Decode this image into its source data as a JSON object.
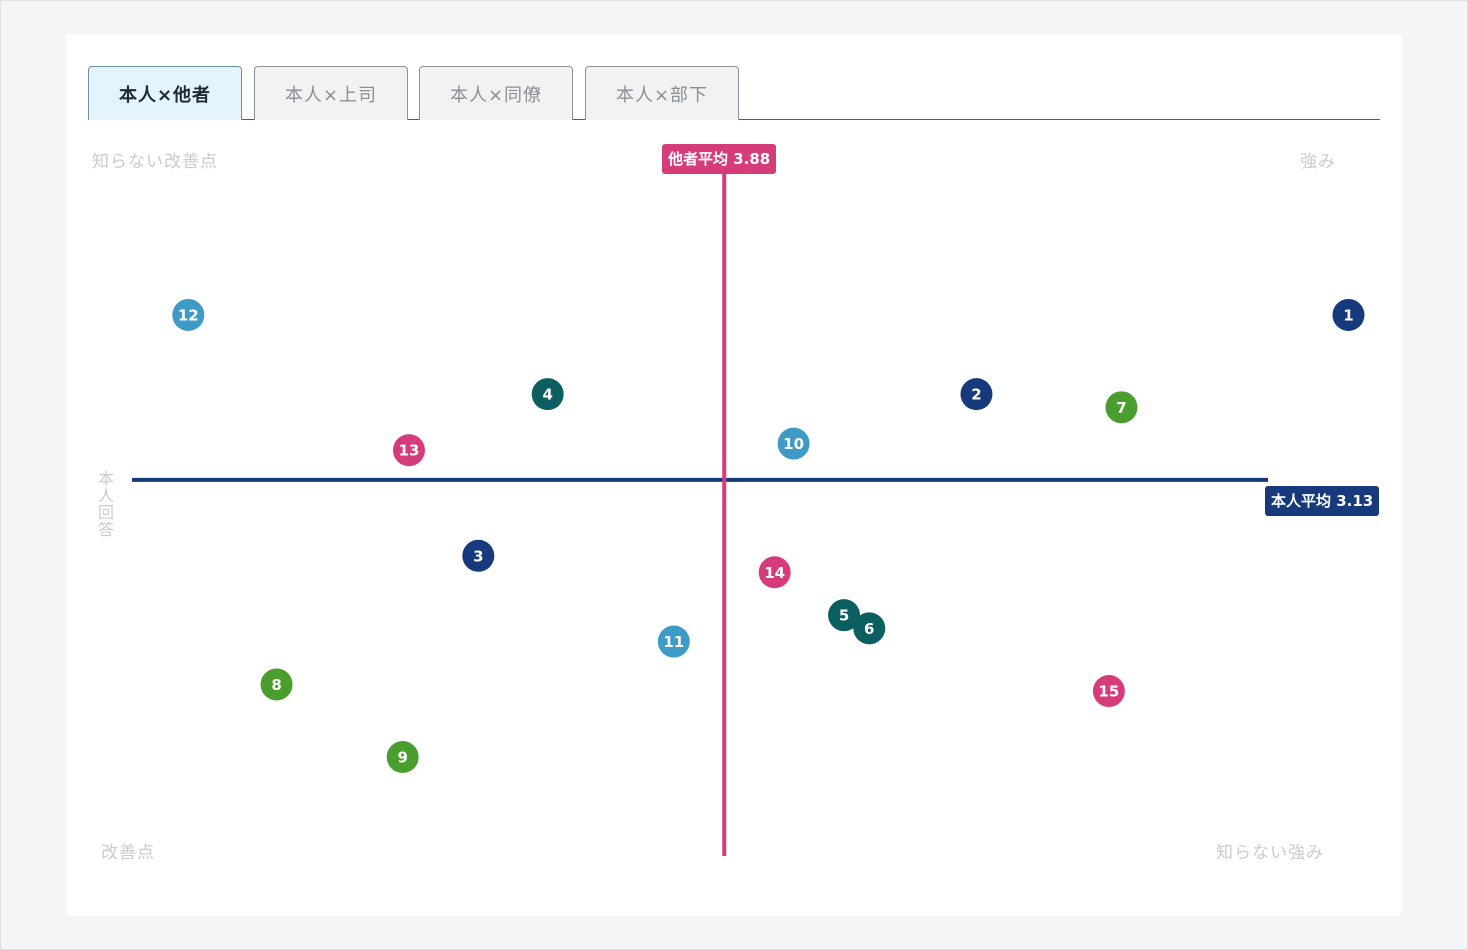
{
  "tabs": [
    {
      "label": "本人×他者",
      "active": true
    },
    {
      "label": "本人×上司",
      "active": false
    },
    {
      "label": "本人×同僚",
      "active": false
    },
    {
      "label": "本人×部下",
      "active": false
    }
  ],
  "quadrant_labels": {
    "top_left": "知らない改善点",
    "top_right": "強み",
    "bottom_left": "改善点",
    "bottom_right": "知らない強み"
  },
  "y_axis_label": "本人回答",
  "averages": {
    "others_label": "他者平均 3.88",
    "self_label": "本人平均 3.13"
  },
  "colors": {
    "navy": "#173a7c",
    "teal": "#0b5f60",
    "green": "#4a9e2e",
    "lightblue": "#3e9bc8",
    "pink": "#d63b7a"
  },
  "chart_data": {
    "type": "scatter",
    "x_label": "",
    "y_label": "本人回答",
    "x_avg": 3.88,
    "y_avg": 3.13,
    "xlim": [
      2.89,
      4.92
    ],
    "ylim": [
      1.99,
      4.13
    ],
    "points": [
      {
        "id": "1",
        "x": 4.87,
        "y": 3.63,
        "color": "navy"
      },
      {
        "id": "2",
        "x": 4.28,
        "y": 3.39,
        "color": "navy"
      },
      {
        "id": "3",
        "x": 3.49,
        "y": 2.9,
        "color": "navy"
      },
      {
        "id": "4",
        "x": 3.6,
        "y": 3.39,
        "color": "teal"
      },
      {
        "id": "5",
        "x": 4.07,
        "y": 2.72,
        "color": "teal"
      },
      {
        "id": "6",
        "x": 4.11,
        "y": 2.68,
        "color": "teal"
      },
      {
        "id": "7",
        "x": 4.51,
        "y": 3.35,
        "color": "green"
      },
      {
        "id": "8",
        "x": 3.17,
        "y": 2.51,
        "color": "green"
      },
      {
        "id": "9",
        "x": 3.37,
        "y": 2.29,
        "color": "green"
      },
      {
        "id": "10",
        "x": 3.99,
        "y": 3.24,
        "color": "lightblue"
      },
      {
        "id": "11",
        "x": 3.8,
        "y": 2.64,
        "color": "lightblue"
      },
      {
        "id": "12",
        "x": 3.03,
        "y": 3.63,
        "color": "lightblue"
      },
      {
        "id": "13",
        "x": 3.38,
        "y": 3.22,
        "color": "pink"
      },
      {
        "id": "14",
        "x": 3.96,
        "y": 2.85,
        "color": "pink"
      },
      {
        "id": "15",
        "x": 4.49,
        "y": 2.49,
        "color": "pink"
      }
    ]
  }
}
